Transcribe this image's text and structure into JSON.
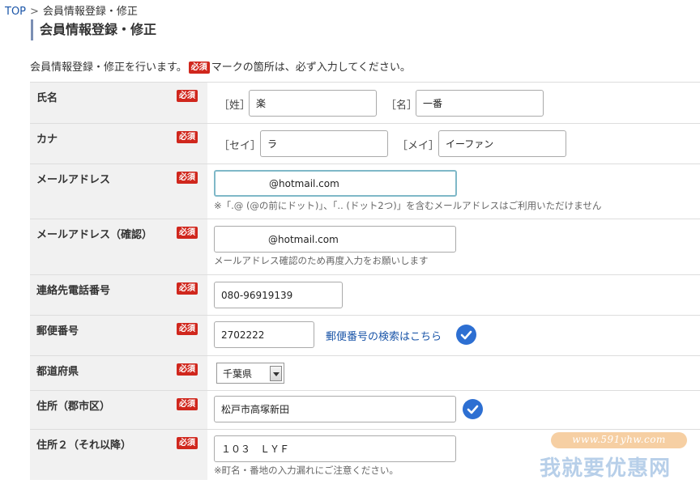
{
  "breadcrumb": {
    "home": "TOP",
    "separator": ">",
    "current": "会員情報登録・修正"
  },
  "page_title": "会員情報登録・修正",
  "intro": {
    "before": "会員情報登録・修正を行います。",
    "badge": "必須",
    "after": "マークの箇所は、必ず入力してください。"
  },
  "required_badge": "必須",
  "colors": {
    "required": "#d0271d",
    "link": "#1a55a8",
    "check": "#2d6fd2",
    "label_bg": "#f1f1f1",
    "title_bar": "#7b8fb4"
  },
  "form": {
    "name": {
      "label": "氏名",
      "sei_label": "［姓］",
      "sei_value": "楽",
      "mei_label": "［名］",
      "mei_value": "一番"
    },
    "kana": {
      "label": "カナ",
      "sei_label": "［セイ］",
      "sei_value": "ラ",
      "mei_label": "［メイ］",
      "mei_value": "イーファン"
    },
    "email": {
      "label": "メールアドレス",
      "value": "@hotmail.com",
      "note": "※「.@ (@の前にドット)」、「.. (ドット2つ)」を含むメールアドレスはご利用いただけません"
    },
    "email_confirm": {
      "label": "メールアドレス（確認）",
      "value": "@hotmail.com",
      "note": "メールアドレス確認のため再度入力をお願いします"
    },
    "phone": {
      "label": "連絡先電話番号",
      "value": "080-96919139"
    },
    "postal": {
      "label": "郵便番号",
      "value": "2702222",
      "search_link": "郵便番号の検索はこちら",
      "icon": "check-circle-icon"
    },
    "prefecture": {
      "label": "都道府県",
      "selected": "千葉県"
    },
    "address1": {
      "label": "住所（郡市区）",
      "value": "松戸市高塚新田",
      "icon": "check-circle-icon"
    },
    "address2": {
      "label": "住所２（それ以降）",
      "value": "１０３　ＬＹＦ",
      "note": "※町名・番地の入力漏れにご注意ください。"
    }
  },
  "watermark": {
    "url": "www.591yhw.com",
    "text": "我就要优惠网"
  }
}
